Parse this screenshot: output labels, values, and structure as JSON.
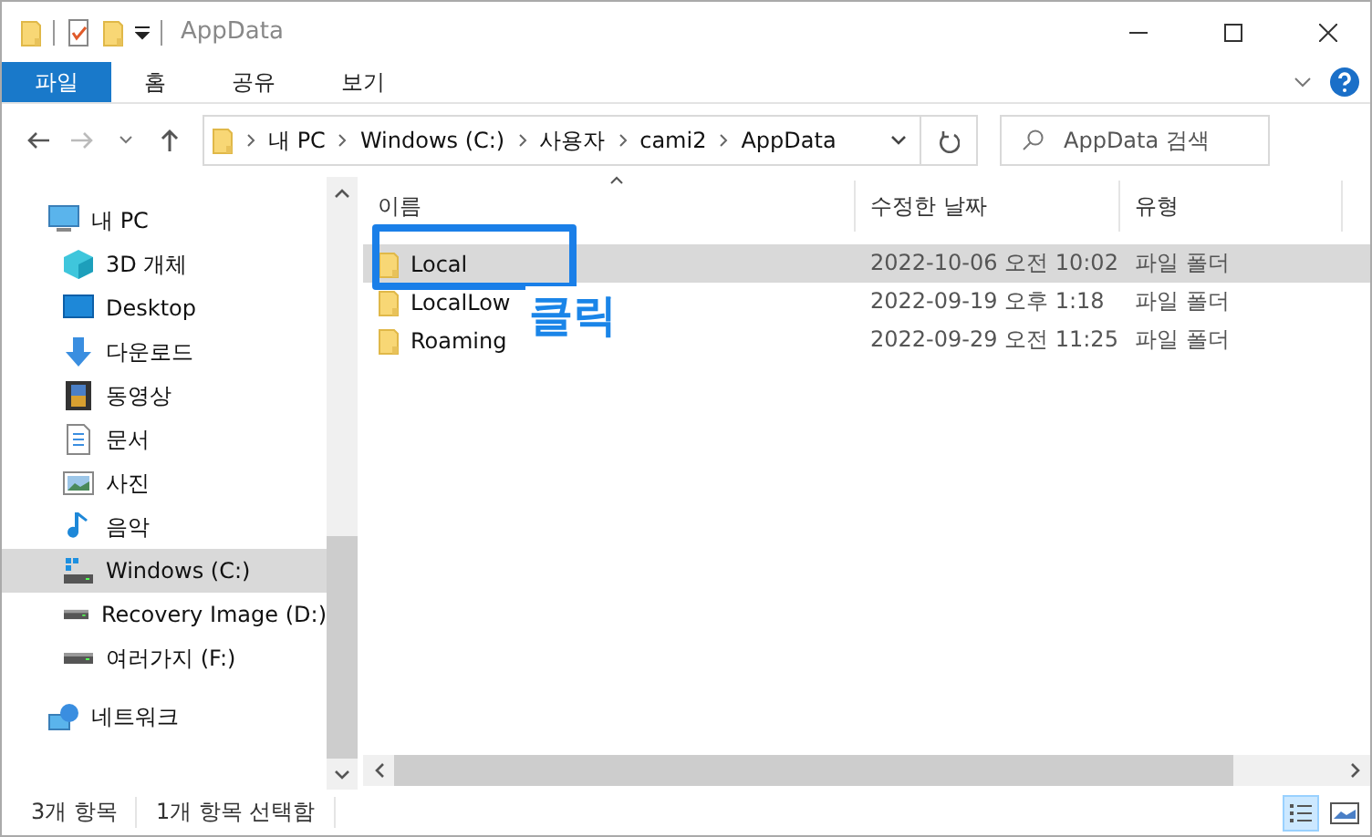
{
  "window": {
    "title": "AppData"
  },
  "ribbon_tabs": [
    {
      "label": "파일",
      "selected": true
    },
    {
      "label": "홈",
      "selected": false
    },
    {
      "label": "공유",
      "selected": false
    },
    {
      "label": "보기",
      "selected": false
    }
  ],
  "address": {
    "path": [
      "내 PC",
      "Windows (C:)",
      "사용자",
      "cami2",
      "AppData"
    ]
  },
  "search": {
    "placeholder": "AppData 검색"
  },
  "sidebar": {
    "items": [
      {
        "label": "내 PC",
        "kind": "pc",
        "selected": false,
        "children": [
          {
            "label": "3D 개체",
            "kind": "cube",
            "selected": false
          },
          {
            "label": "Desktop",
            "kind": "desktop",
            "selected": false
          },
          {
            "label": "다운로드",
            "kind": "download",
            "selected": false
          },
          {
            "label": "동영상",
            "kind": "video",
            "selected": false
          },
          {
            "label": "문서",
            "kind": "document",
            "selected": false
          },
          {
            "label": "사진",
            "kind": "photo",
            "selected": false
          },
          {
            "label": "음악",
            "kind": "music",
            "selected": false
          },
          {
            "label": "Windows (C:)",
            "kind": "system-drive",
            "selected": true
          },
          {
            "label": "Recovery Image (D:)",
            "kind": "drive",
            "selected": false
          },
          {
            "label": "여러가지 (F:)",
            "kind": "drive",
            "selected": false
          }
        ]
      },
      {
        "label": "네트워크",
        "kind": "network",
        "selected": false
      }
    ]
  },
  "table": {
    "columns": [
      "이름",
      "수정한 날짜",
      "유형"
    ],
    "rows": [
      {
        "name": "Local",
        "modified": "2022-10-06 오전 10:02",
        "type": "파일 폴더",
        "selected": true
      },
      {
        "name": "LocalLow",
        "modified": "2022-09-19 오후 1:18",
        "type": "파일 폴더",
        "selected": false
      },
      {
        "name": "Roaming",
        "modified": "2022-09-29 오전 11:25",
        "type": "파일 폴더",
        "selected": false
      }
    ]
  },
  "annotation": {
    "label": "클릭"
  },
  "status_bar": {
    "item_count": "3개 항목",
    "selection": "1개 항목 선택함"
  }
}
